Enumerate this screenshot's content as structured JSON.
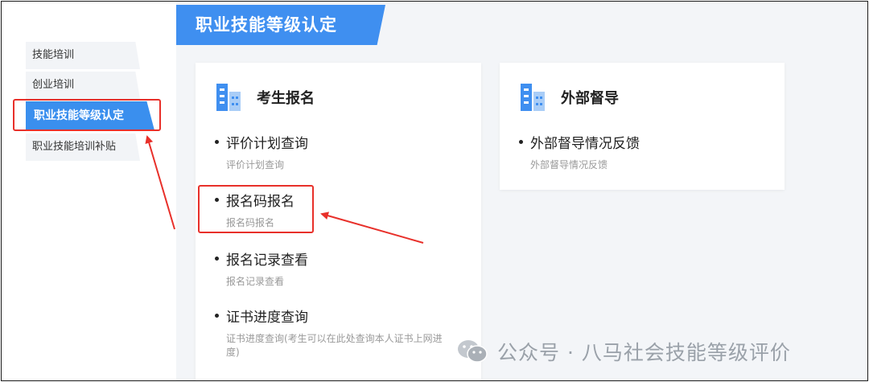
{
  "sidebar": {
    "items": [
      {
        "label": "技能培训"
      },
      {
        "label": "创业培训"
      },
      {
        "label": "职业技能等级认定"
      },
      {
        "label": "职业技能培训补贴"
      }
    ]
  },
  "main": {
    "title": "职业技能等级认定",
    "cards": [
      {
        "title": "考生报名",
        "entries": [
          {
            "title": "评价计划查询",
            "desc": "评价计划查询"
          },
          {
            "title": "报名码报名",
            "desc": "报名码报名"
          },
          {
            "title": "报名记录查看",
            "desc": "报名记录查看"
          },
          {
            "title": "证书进度查询",
            "desc": "证书进度查询(考生可以在此处查询本人证书上网进度)"
          }
        ]
      },
      {
        "title": "外部督导",
        "entries": [
          {
            "title": "外部督导情况反馈",
            "desc": "外部督导情况反馈"
          }
        ]
      }
    ]
  },
  "watermark": {
    "text": "公众号 · 八马社会技能等级评价"
  },
  "colors": {
    "accent": "#3f8ff0",
    "annotation": "#e8302a",
    "background": "#f3f5f8"
  }
}
